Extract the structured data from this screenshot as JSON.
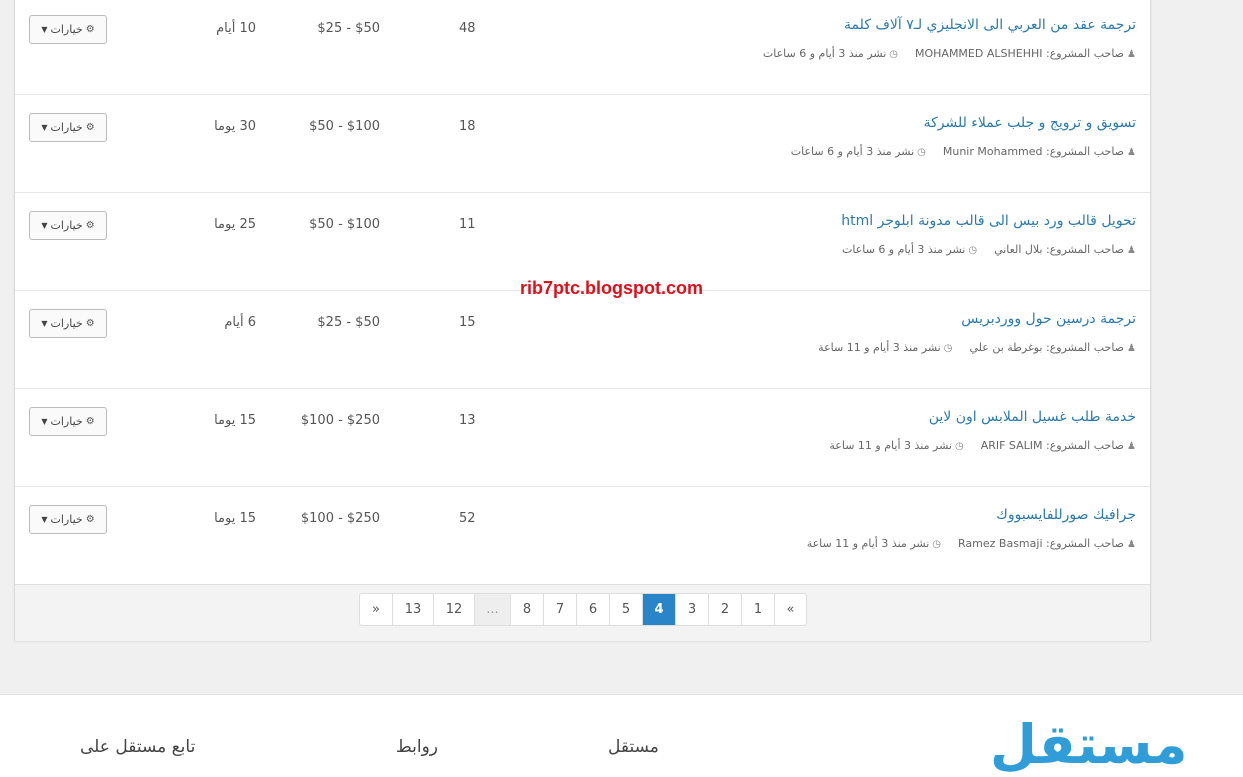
{
  "projects": [
    {
      "title": "ترجمة عقد من العربي الى الانجليزي لـ٧ آلاف كلمة",
      "owner_label": "صاحب المشروع:",
      "owner": "MOHAMMED ALSHEHHI",
      "posted": "نشر منذ 3 أيام و 6 ساعات",
      "bids": "48",
      "budget": "$25 - $50",
      "duration": "10 أيام",
      "options": "خيارات"
    },
    {
      "title": "تسويق و ترويج و جلب عملاء للشركة",
      "owner_label": "صاحب المشروع:",
      "owner": "Munir Mohammed",
      "posted": "نشر منذ 3 أيام و 6 ساعات",
      "bids": "18",
      "budget": "$50 - $100",
      "duration": "30 يوما",
      "options": "خيارات"
    },
    {
      "title": "تحويل قالب ورد بيس الى قالب مدونة ابلوجر html",
      "owner_label": "صاحب المشروع:",
      "owner": "بلال العاني",
      "posted": "نشر منذ 3 أيام و 6 ساعات",
      "bids": "11",
      "budget": "$50 - $100",
      "duration": "25 يوما",
      "options": "خيارات"
    },
    {
      "title": "ترجمة درسين حول ووردبريس",
      "owner_label": "صاحب المشروع:",
      "owner": "بوغرطة بن علي",
      "posted": "نشر منذ 3 أيام و 11 ساعة",
      "bids": "15",
      "budget": "$25 - $50",
      "duration": "6 أيام",
      "options": "خيارات"
    },
    {
      "title": "خدمة طلب غسيل الملابس اون لاين",
      "owner_label": "صاحب المشروع:",
      "owner": "ARIF SALIM",
      "posted": "نشر منذ 3 أيام و 11 ساعة",
      "bids": "13",
      "budget": "$100 - $250",
      "duration": "15 يوما",
      "options": "خيارات"
    },
    {
      "title": "جرافيك صورللفايسبووك",
      "owner_label": "صاحب المشروع:",
      "owner": "Ramez Basmaji",
      "posted": "نشر منذ 3 أيام و 11 ساعة",
      "bids": "52",
      "budget": "$100 - $250",
      "duration": "15 يوما",
      "options": "خيارات"
    }
  ],
  "pagination": {
    "items": [
      "»",
      "13",
      "12",
      "...",
      "8",
      "7",
      "6",
      "5",
      "4",
      "3",
      "2",
      "1",
      "«"
    ],
    "active": "4"
  },
  "watermark": "rib7ptc.blogspot.com",
  "footer": {
    "logo": "مستقل",
    "col_about": "مستقل",
    "col_links": "روابط",
    "col_follow": "تابع مستقل على"
  },
  "colors": {
    "link": "#2a7ab0",
    "active_page": "#2a84c8",
    "logo": "#2f9ed8",
    "watermark": "#e0101b"
  }
}
